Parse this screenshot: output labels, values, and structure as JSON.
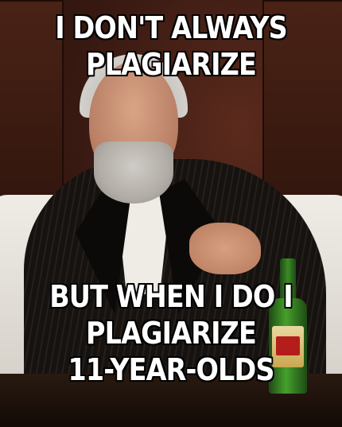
{
  "meme": {
    "top_lines": [
      "I DON'T ALWAYS",
      "PLAGIARIZE"
    ],
    "bottom_lines": [
      "BUT WHEN I DO I",
      "PLAGIARIZE",
      "11-YEAR-OLDS"
    ]
  },
  "colors": {
    "text": "#ffffff",
    "outline": "#000000",
    "background": "#3a1a12"
  }
}
